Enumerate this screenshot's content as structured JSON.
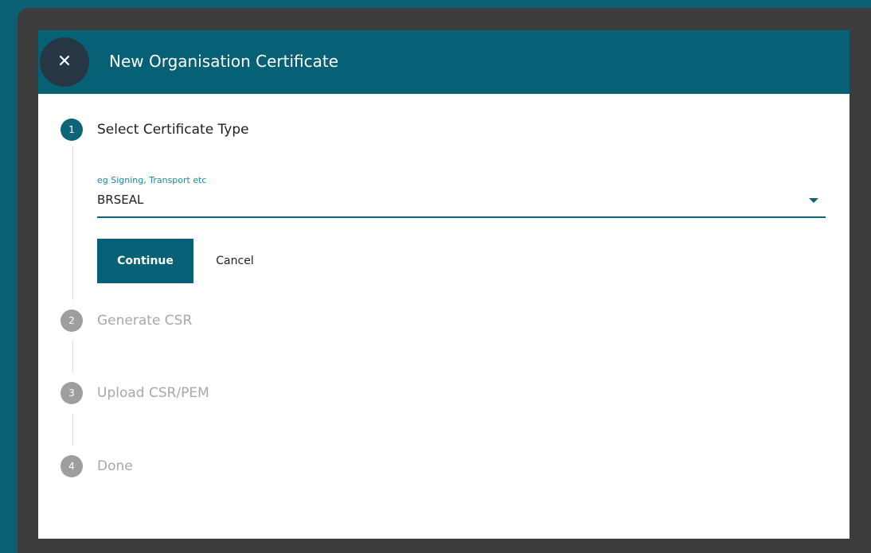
{
  "dialog": {
    "title": "New Organisation Certificate",
    "close_icon": "close-icon"
  },
  "steps": [
    {
      "number": "1",
      "label": "Select Certificate Type",
      "state": "active"
    },
    {
      "number": "2",
      "label": "Generate CSR",
      "state": "inactive"
    },
    {
      "number": "3",
      "label": "Upload CSR/PEM",
      "state": "inactive"
    },
    {
      "number": "4",
      "label": "Done",
      "state": "inactive"
    }
  ],
  "certificate_type": {
    "label": "eg Signing, Transport etc",
    "value": "BRSEAL",
    "dropdown_icon": "dropdown-arrow-icon"
  },
  "actions": {
    "continue_label": "Continue",
    "cancel_label": "Cancel"
  },
  "colors": {
    "page_background": "#0b6074",
    "frame": "#3c3c3c",
    "header": "#066076",
    "close_button": "#263743",
    "accent": "#0d6478",
    "inactive": "#9e9e9e"
  }
}
